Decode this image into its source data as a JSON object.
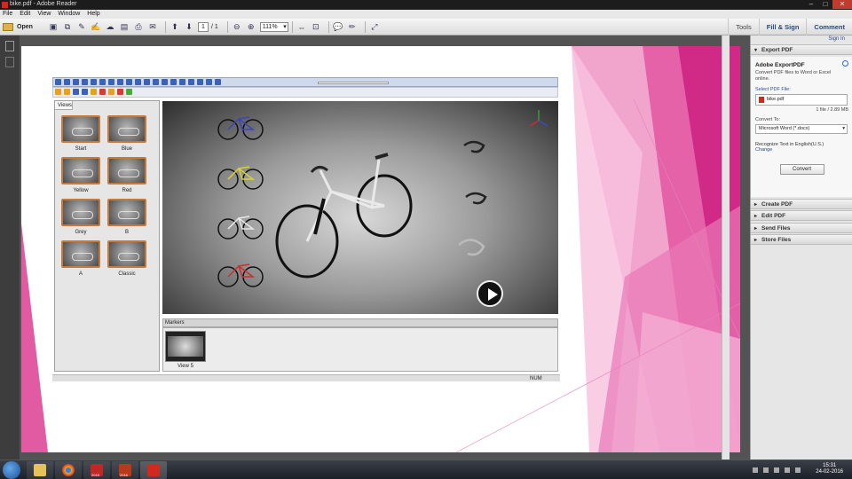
{
  "window": {
    "title": "bike.pdf - Adobe Reader"
  },
  "menu": [
    "File",
    "Edit",
    "View",
    "Window",
    "Help"
  ],
  "toolbar": {
    "open_label": "Open",
    "page_current": "1",
    "page_total": "/ 1",
    "zoom": "111%",
    "right_tabs": [
      "Tools",
      "Fill & Sign",
      "Comment"
    ]
  },
  "views_panel": {
    "tab": "Views",
    "items": [
      "Start",
      "Blue",
      "Yellow",
      "Red",
      "Grey",
      "B",
      "A",
      "Classic"
    ]
  },
  "markers_panel": {
    "header": "Markers",
    "items": [
      "View 5"
    ]
  },
  "statusbar": {
    "text": "NUM"
  },
  "right_panel": {
    "sign_in": "Sign In",
    "export_pdf": {
      "header": "Export PDF",
      "title": "Adobe ExportPDF",
      "description": "Convert PDF files to Word or Excel online.",
      "select_label": "Select PDF File:",
      "file_name": "bike.pdf",
      "file_info": "1 file / 2.89 MB",
      "convert_to_label": "Convert To:",
      "convert_to_value": "Microsoft Word (*.docx)",
      "recognize": "Recognize Text in English(U.S.)",
      "change": "Change",
      "convert_button": "Convert"
    },
    "sections": [
      "Create PDF",
      "Edit PDF",
      "Send Files",
      "Store Files"
    ]
  },
  "taskbar": {
    "time": "15:31",
    "date": "24-02-2016",
    "app_badges": [
      "2015",
      "2016"
    ]
  },
  "colors": {
    "accent_pink": "#e0348c",
    "adobe_red": "#d02a1e",
    "link_blue": "#2a4a90"
  }
}
